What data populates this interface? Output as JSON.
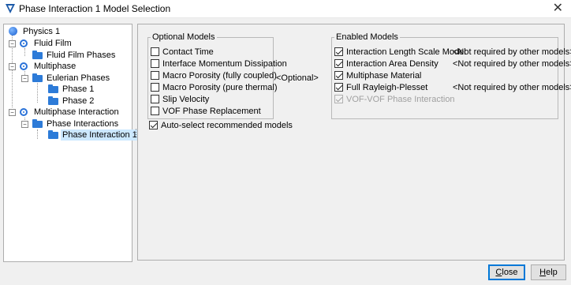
{
  "window": {
    "title": "Phase Interaction 1 Model Selection",
    "close_glyph": "✕"
  },
  "tree": {
    "root": "Physics 1",
    "fluid_film": "Fluid Film",
    "fluid_film_phases": "Fluid Film Phases",
    "multiphase": "Multiphase",
    "eulerian_phases": "Eulerian Phases",
    "phase_1": "Phase 1",
    "phase_2": "Phase 2",
    "multiphase_interaction": "Multiphase Interaction",
    "phase_interactions": "Phase Interactions",
    "phase_interaction_1": "Phase Interaction 1"
  },
  "optional_models": {
    "title": "Optional Models",
    "items": [
      {
        "label": "Contact Time",
        "checked": false
      },
      {
        "label": "Interface Momentum Dissipation",
        "checked": false
      },
      {
        "label": "Macro Porosity (fully coupled)",
        "checked": false
      },
      {
        "label": "Macro Porosity (pure thermal)",
        "checked": false
      },
      {
        "label": "Slip Velocity",
        "checked": false
      },
      {
        "label": "VOF Phase Replacement",
        "checked": false
      }
    ]
  },
  "optional_tag": "<Optional>",
  "auto_select": {
    "label": "Auto-select recommended models",
    "checked": true
  },
  "enabled_models": {
    "title": "Enabled Models",
    "items": [
      {
        "label": "Interaction Length Scale Model",
        "note": "<Not required by other models>",
        "checked": true,
        "disabled": false
      },
      {
        "label": "Interaction Area Density",
        "note": "<Not required by other models>",
        "checked": true,
        "disabled": false
      },
      {
        "label": "Multiphase Material",
        "note": "",
        "checked": true,
        "disabled": false
      },
      {
        "label": "Full Rayleigh-Plesset",
        "note": "<Not required by other models>",
        "checked": true,
        "disabled": false
      },
      {
        "label": "VOF-VOF Phase Interaction",
        "note": "",
        "checked": true,
        "disabled": true
      }
    ]
  },
  "buttons": {
    "close_pre": "",
    "close_key": "C",
    "close_post": "lose",
    "help_pre": "",
    "help_key": "H",
    "help_post": "elp"
  },
  "colors": {
    "selection": "#cce8ff",
    "accent": "#0078d7",
    "icon_blue": "#2d7bd8"
  }
}
